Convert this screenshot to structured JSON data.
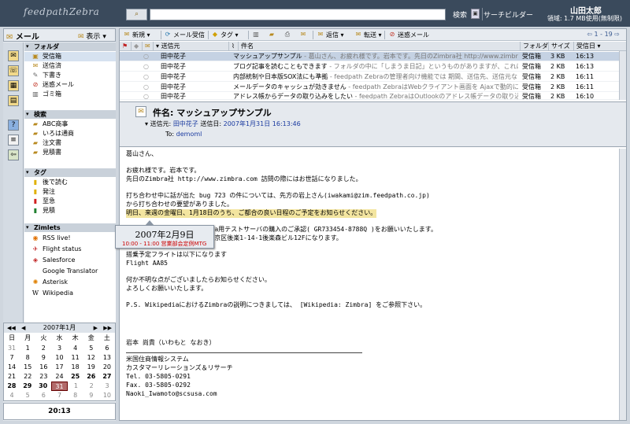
{
  "header": {
    "logo": "feedpathZebra",
    "search_type_icon": "⌕",
    "search_placeholder": "",
    "search_button": "検索",
    "save_icon": "▣",
    "search_builder": "サーチビルダー",
    "username": "山田太郎",
    "quota": "領域: 1.7 MB使用(無制限)"
  },
  "appbar": {
    "app_label": "メール",
    "view_label": "表示"
  },
  "sidebar": {
    "folders_title": "フォルダ",
    "folders": [
      "受信箱",
      "送信済",
      "下書き",
      "迷惑メール",
      "ゴミ箱"
    ],
    "searches_title": "検索",
    "searches": [
      "ABC商事",
      "いろは通商",
      "注文書",
      "見積書"
    ],
    "tags_title": "タグ",
    "tags": [
      "後で読む",
      "発注",
      "至急",
      "見積"
    ],
    "zimlets_title": "Zimlets",
    "zimlets": [
      "RSS live!",
      "Flight status",
      "Salesforce",
      "Google Translator",
      "Asterisk",
      "Wikipedia"
    ]
  },
  "calendar": {
    "month_label": "2007年1月",
    "dow": [
      "日",
      "月",
      "火",
      "水",
      "木",
      "金",
      "土"
    ],
    "weeks": [
      [
        "31",
        "1",
        "2",
        "3",
        "4",
        "5",
        "6"
      ],
      [
        "7",
        "8",
        "9",
        "10",
        "11",
        "12",
        "13"
      ],
      [
        "14",
        "15",
        "16",
        "17",
        "18",
        "19",
        "20"
      ],
      [
        "21",
        "22",
        "23",
        "24",
        "25",
        "26",
        "27"
      ],
      [
        "28",
        "29",
        "30",
        "31",
        "1",
        "2",
        "3"
      ],
      [
        "4",
        "5",
        "6",
        "7",
        "8",
        "9",
        "10"
      ]
    ]
  },
  "clock": "20:13",
  "toolbar": {
    "new": "新規",
    "receive": "メール受信",
    "tag": "タグ",
    "reply": "返信",
    "forward": "転送",
    "spam": "迷惑メール",
    "pager": "1 - 19"
  },
  "list": {
    "columns": {
      "from": "送信元",
      "subject": "件名",
      "folder": "フォルダ",
      "size": "サイズ",
      "date": "受信日"
    },
    "rows": [
      {
        "from": "田中花子",
        "subject": "マッシュアップサンプル",
        "fragment": " - 葛山さん、お疲れ様です。岩本です。先日のZimbra社 http://www.zimbra.com 訪問の際",
        "folder": "受信箱",
        "size": "3 KB",
        "date": "16:13"
      },
      {
        "from": "田中花子",
        "subject": "ブログ記事を読むこともできます",
        "fragment": " - フォルダの中に「しまうま日記」というものがありますが、これはRSSフィードになって",
        "folder": "受信箱",
        "size": "2 KB",
        "date": "16:13"
      },
      {
        "from": "田中花子",
        "subject": "内部統制や日本版SOX法にも準拠",
        "fragment": " - feedpath Zebraの管理者向け機能では 期間、送信先、送信元などの情",
        "folder": "受信箱",
        "size": "2 KB",
        "date": "16:11"
      },
      {
        "from": "田中花子",
        "subject": "メールデータのキャッシュが効きません",
        "fragment": " - feedpath ZebraはWebクライアント画面を Ajaxで動的に生成するため、クラ",
        "folder": "受信箱",
        "size": "2 KB",
        "date": "16:11"
      },
      {
        "from": "田中花子",
        "subject": "アドレス帳からデータの取り込みをしたい",
        "fragment": " - feedpath ZebraはOutlookのアドレス帳データの取り込みに対応",
        "folder": "受信箱",
        "size": "2 KB",
        "date": "16:10"
      }
    ]
  },
  "message": {
    "subject": "件名: マッシュアップサンプル",
    "from_label": "送信元:",
    "from": "田中花子",
    "date_label": "送信日:",
    "date": "2007年1月31日 16:13:46",
    "to_label": "To:",
    "to": "demoml",
    "body": [
      "葛山さん、",
      "",
      "お疲れ様です。岩本です。",
      "先日のZimbra社 http://www.zimbra.com 訪問の際にはお世話になりました。",
      "",
      "打ち合わせ中に話が出た bug 723 の件については、先方の岩上さん(iwakami@zim.feedpath.co.jp)",
      "から打ち合わせの要望がありました。",
      "明日、来週の金曜日、1月18日のうち、ご都合の良い日程のご予定をお知らせください。",
      "",
      "               ますZimbra用テストサーバの購入のご承認( GR733454-8788Q )をお願いいたします。",
      "               は東京都文京区後楽1-14-1後楽森ビル12Fになります。",
      "",
      "搭乗予定フライトは以下になります",
      "Flight AA85",
      "",
      "何か不明な点がございましたらお知らせください。",
      "よろしくお願いいたします。",
      "",
      "P.S. WikipediaにおけるZimbraの説明につきましては、 [Wikipedia: Zimbra] をご参照下さい。",
      "",
      "",
      "",
      "岩本 尚貴（いわもと なおき）",
      "",
      "米国住商情報システム",
      "カスタマーリレーションズ＆リサーチ",
      "Tel. 03-5805-0291",
      "Fax. 03-5805-0292",
      "Naoki_Iwamoto@scsusa.com"
    ]
  },
  "popup": {
    "date": "2007年2月9日",
    "event": "10:00 - 11:00 営業部会定例MTG"
  }
}
